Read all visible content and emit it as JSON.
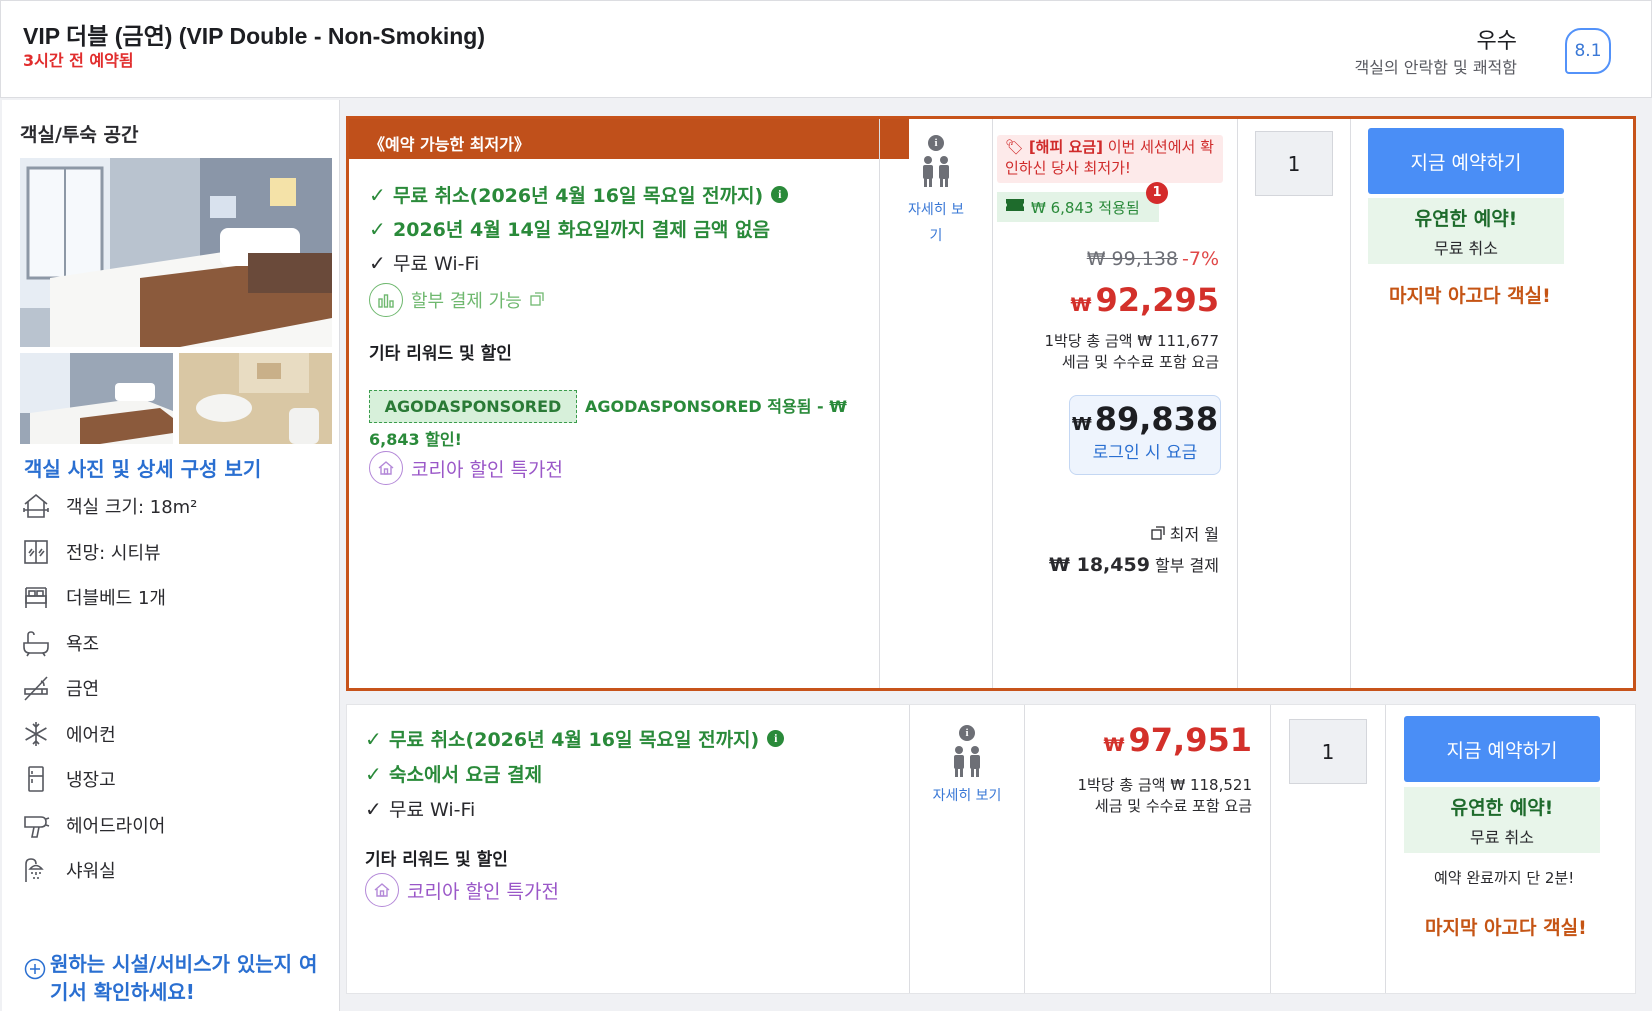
{
  "header": {
    "room_title": "VIP 더블 (금연) (VIP Double - Non-Smoking)",
    "booked_ago": "3시간 전 예약됨",
    "rating_word": "우수",
    "rating_sub": "객실의 안락함 및 쾌적함",
    "rating_score": "8.1"
  },
  "left": {
    "heading": "객실/투숙 공간",
    "photo_link": "객실 사진 및 상세 구성 보기",
    "amenities": [
      {
        "icon": "house-size-icon",
        "label": "객실 크기: 18m²"
      },
      {
        "icon": "window-view-icon",
        "label": "전망: 시티뷰"
      },
      {
        "icon": "double-bed-icon",
        "label": "더블베드 1개"
      },
      {
        "icon": "bathtub-icon",
        "label": "욕조"
      },
      {
        "icon": "no-smoking-icon",
        "label": "금연"
      },
      {
        "icon": "snowflake-icon",
        "label": "에어컨"
      },
      {
        "icon": "fridge-icon",
        "label": "냉장고"
      },
      {
        "icon": "hair-dryer-icon",
        "label": "헤어드라이어"
      },
      {
        "icon": "shower-icon",
        "label": "샤워실"
      }
    ],
    "ask_text": "원하는 시설/서비스가 있는지 여기서 확인하세요!"
  },
  "offer1": {
    "ribbon": "《예약 가능한 최저가》",
    "features": {
      "free_cancel": "무료 취소(2026년 4월 16일 목요일 전까지)",
      "no_payment": "2026년 4월 14일 화요일까지 결제 금액 없음",
      "wifi": "무료 Wi-Fi"
    },
    "installment": "할부 결제 가능",
    "rewards_heading": "기타 리워드 및 할인",
    "coupon_code": "AGODASPONSORED",
    "coupon_text": "AGODASPONSORED 적용됨 - ₩ 6,843 할인!",
    "promo": "코리아 할인 특가전",
    "occupancy_link": "자세히 보기",
    "happy_label": "[해피 요금]",
    "happy_text": "이번 세션에서 확인하신 당사 최저가!",
    "applied": "₩ 6,843 적용됨",
    "applied_badge": "1",
    "original_price": "₩ 99,138",
    "discount_pct": "-7%",
    "currency": "₩",
    "price": "92,295",
    "per_night": "1박당 총 금액 ₩ 111,677",
    "tax_note": "세금 및 수수료 포함 요금",
    "login_price": "89,838",
    "login_label": "로그인 시 요금",
    "monthly_label": "최저 월",
    "monthly_amount": "₩ 18,459",
    "monthly_suffix": "할부 결제",
    "qty": "1",
    "book_label": "지금 예약하기",
    "flex_title": "유연한 예약!",
    "flex_sub": "무료 취소",
    "last_room": "마지막 아고다 객실!"
  },
  "offer2": {
    "features": {
      "free_cancel": "무료 취소(2026년 4월 16일 목요일 전까지)",
      "pay_at_property": "숙소에서 요금 결제",
      "wifi": "무료 Wi-Fi"
    },
    "rewards_heading": "기타 리워드 및 할인",
    "promo": "코리아 할인 특가전",
    "occupancy_link": "자세히 보기",
    "currency": "₩",
    "price": "97,951",
    "per_night": "1박당 총 금액 ₩ 118,521",
    "tax_note": "세금 및 수수료 포함 요금",
    "qty": "1",
    "book_label": "지금 예약하기",
    "flex_title": "유연한 예약!",
    "flex_sub": "무료 취소",
    "minutes_note": "예약 완료까지 단 2분!",
    "last_room": "마지막 아고다 객실!"
  },
  "colors": {
    "accent_blue": "#4a8ef6",
    "ribbon_orange": "#c0501b",
    "price_red": "#d3302a",
    "feature_green": "#2a8a3a"
  }
}
